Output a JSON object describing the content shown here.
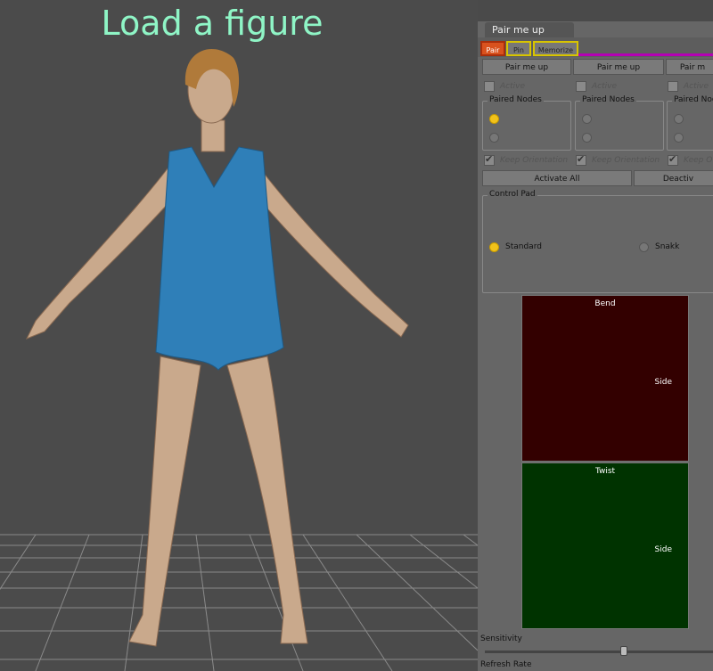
{
  "viewport": {
    "caption": "Load a figure",
    "caption_color": "#8ff5c6",
    "background": "#4b4b4b",
    "figure_outfit_color": "#2f7fb8"
  },
  "panel": {
    "title": "Pair me up",
    "tabs": [
      {
        "label": "Pair",
        "color": "#d9521e"
      },
      {
        "label": "Pin",
        "color": "#d8c400"
      },
      {
        "label": "Memorize",
        "color": "#d8c400"
      }
    ],
    "pair_buttons": [
      "Pair me up",
      "Pair me up",
      "Pair m"
    ],
    "active_labels": [
      "Active",
      "Active",
      "Active"
    ],
    "paired_nodes_titles": [
      "Paired Nodes",
      "Paired Nodes",
      "Paired Noc"
    ],
    "keep_orientation_labels": [
      "Keep Orientation",
      "Keep Orientation",
      "Keep O"
    ],
    "activate_all_label": "Activate All",
    "deactivate_label": "Deactiv",
    "control_pad": {
      "title": "Control Pad",
      "options": [
        "Standard",
        "Snakk"
      ],
      "selected": "Standard"
    },
    "bend_pad": {
      "label": "Bend",
      "side_label": "Side",
      "color": "#330000"
    },
    "twist_pad": {
      "label": "Twist",
      "side_label": "Side",
      "color": "#003300"
    },
    "sensitivity_label": "Sensitivity",
    "refresh_rate_label": "Refresh Rate",
    "sensitivity_value": 0.61
  }
}
